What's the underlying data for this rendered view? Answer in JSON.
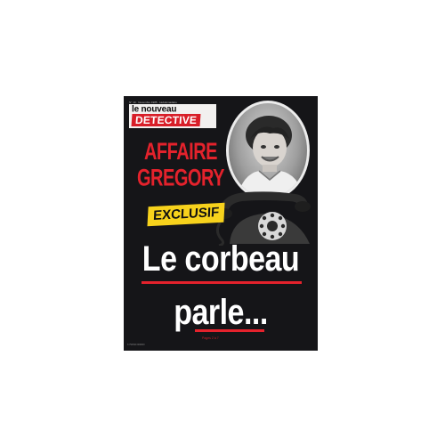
{
  "cover": {
    "issue_line": "N° 10 · Novembre 1985 · Hebdomadaire",
    "masthead_top": "le nouveau",
    "masthead_main": "DETECTIVE",
    "headline_1": "AFFAIRE",
    "headline_2": "GREGORY",
    "badge": "EXCLUSIF",
    "main_line_1": "Le corbeau",
    "main_line_2": "parle...",
    "page_ref": "Pages 2 à 7",
    "barcode_text": "3 791520 000000"
  },
  "colors": {
    "background": "#151518",
    "accent_red": "#e4222c",
    "badge_yellow": "#f7d21c",
    "masthead_bg": "#f2f0ef"
  },
  "icons": [
    "child-portrait-photo",
    "telephone-image"
  ]
}
